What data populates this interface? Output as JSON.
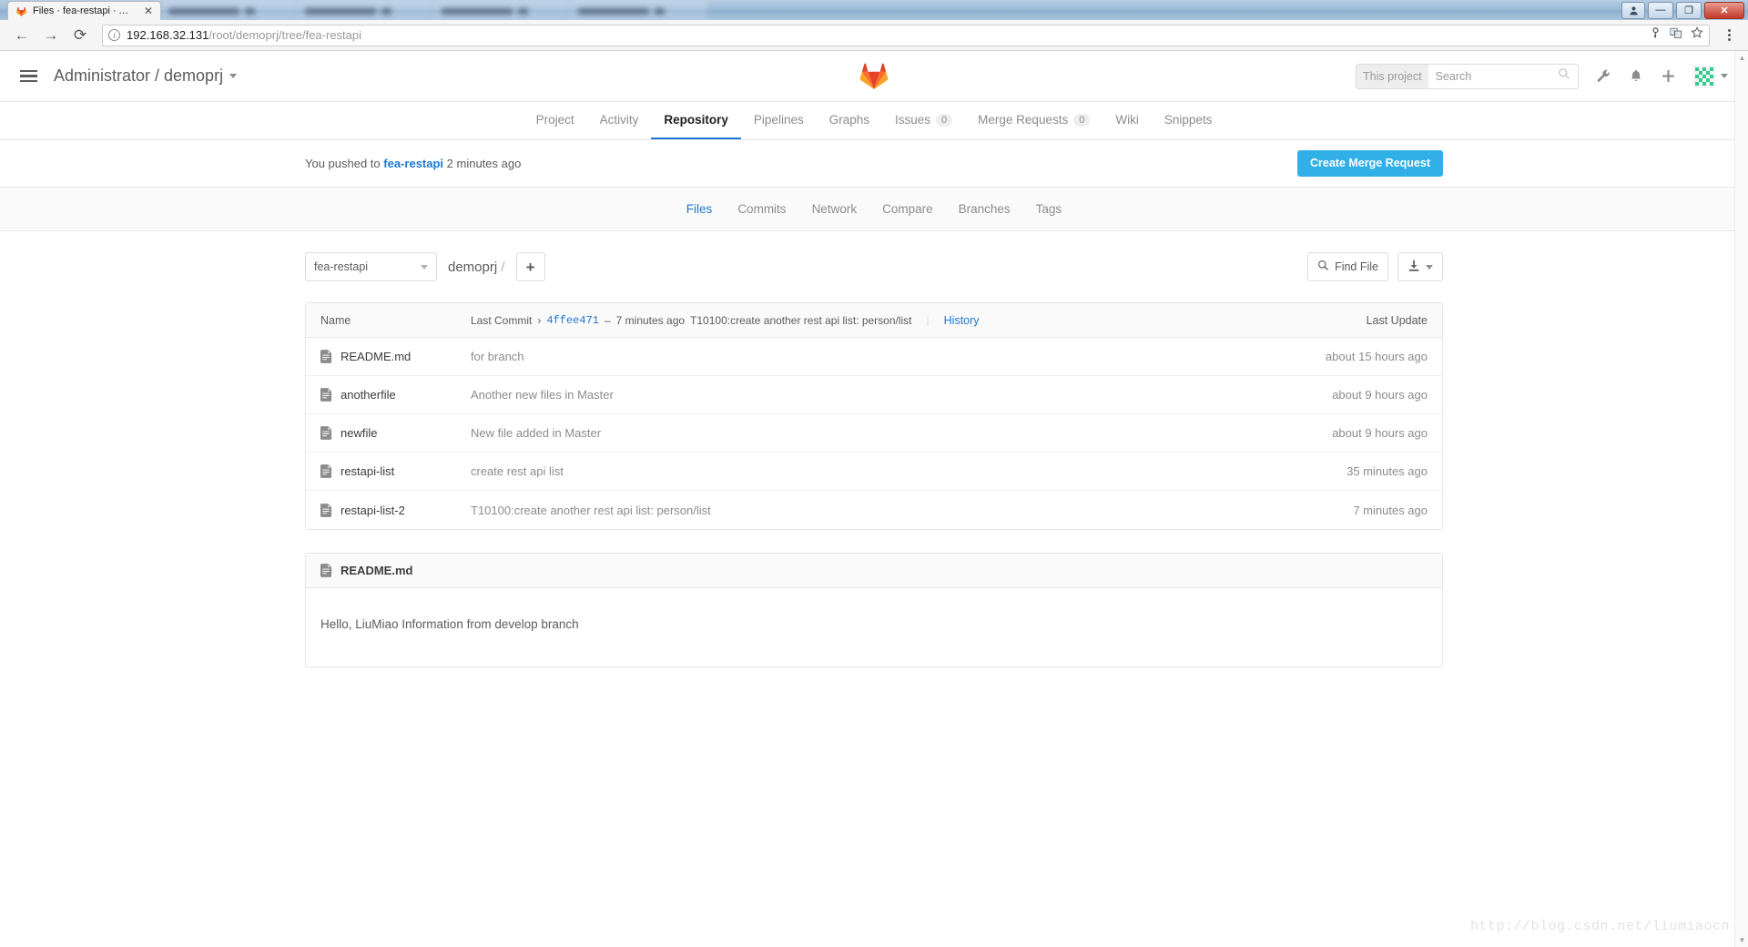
{
  "browser": {
    "active_tab": {
      "title": "Files · fea-restapi · Adm",
      "favicon": "gitlab-icon",
      "close_label": "✕"
    },
    "other_tabs_count": 4,
    "url_host": "192.168.32.131",
    "url_path": "/root/demoprj/tree/fea-restapi",
    "omnibox_icons": [
      "info-icon",
      "key-icon",
      "translate-icon",
      "bookmark-star-icon"
    ],
    "nav": {
      "back": "←",
      "forward": "→",
      "reload": "⟳"
    },
    "window_controls": {
      "person": "person-icon",
      "minimize": "—",
      "restore": "❐",
      "close": "✕"
    }
  },
  "header": {
    "menu_icon": "hamburger-icon",
    "project_path": "Administrator / demoprj",
    "logo": "gitlab-logo",
    "search": {
      "scope": "This project",
      "placeholder": "Search",
      "value": ""
    },
    "icons": [
      "wrench-icon",
      "bell-icon",
      "plus-icon"
    ],
    "avatar": "user-identicon",
    "settings_gear": "gear-icon"
  },
  "nav": {
    "items": [
      {
        "label": "Project",
        "badge": null,
        "active": false
      },
      {
        "label": "Activity",
        "badge": null,
        "active": false
      },
      {
        "label": "Repository",
        "badge": null,
        "active": true
      },
      {
        "label": "Pipelines",
        "badge": null,
        "active": false
      },
      {
        "label": "Graphs",
        "badge": null,
        "active": false
      },
      {
        "label": "Issues",
        "badge": "0",
        "active": false
      },
      {
        "label": "Merge Requests",
        "badge": "0",
        "active": false
      },
      {
        "label": "Wiki",
        "badge": null,
        "active": false
      },
      {
        "label": "Snippets",
        "badge": null,
        "active": false
      }
    ]
  },
  "push_bar": {
    "prefix": "You pushed to",
    "branch": "fea-restapi",
    "suffix": "2 minutes ago",
    "button_label": "Create Merge Request",
    "button_color": "#31b0e8"
  },
  "subnav": {
    "items": [
      {
        "label": "Files",
        "active": true
      },
      {
        "label": "Commits",
        "active": false
      },
      {
        "label": "Network",
        "active": false
      },
      {
        "label": "Compare",
        "active": false
      },
      {
        "label": "Branches",
        "active": false
      },
      {
        "label": "Tags",
        "active": false
      }
    ]
  },
  "toolbar": {
    "branch": "fea-restapi",
    "breadcrumb_project": "demoprj",
    "breadcrumb_sep": "/",
    "add_label": "+",
    "find_file_label": "Find File",
    "download_icon": "download-icon"
  },
  "file_table": {
    "headers": {
      "name": "Name",
      "last_commit": "Last Commit",
      "chevron": "›",
      "history": "History",
      "last_update": "Last Update"
    },
    "head_commit": {
      "sha": "4ffee471",
      "dash": "–",
      "time": "7 minutes ago",
      "message": "T10100:create another rest api list: person/list"
    },
    "rows": [
      {
        "icon": "file-icon",
        "name": "README.md",
        "commit": "for branch",
        "updated": "about 15 hours ago"
      },
      {
        "icon": "file-icon",
        "name": "anotherfile",
        "commit": "Another new files in Master",
        "updated": "about 9 hours ago"
      },
      {
        "icon": "file-icon",
        "name": "newfile",
        "commit": "New file added in Master",
        "updated": "about 9 hours ago"
      },
      {
        "icon": "file-icon",
        "name": "restapi-list",
        "commit": "create rest api list",
        "updated": "35 minutes ago"
      },
      {
        "icon": "file-icon",
        "name": "restapi-list-2",
        "commit": "T10100:create another rest api list: person/list",
        "updated": "7 minutes ago"
      }
    ]
  },
  "readme": {
    "icon": "file-icon",
    "title": "README.md",
    "body": "Hello, LiuMiao Information from develop branch"
  },
  "watermark": "http://blog.csdn.net/liumiaocn"
}
